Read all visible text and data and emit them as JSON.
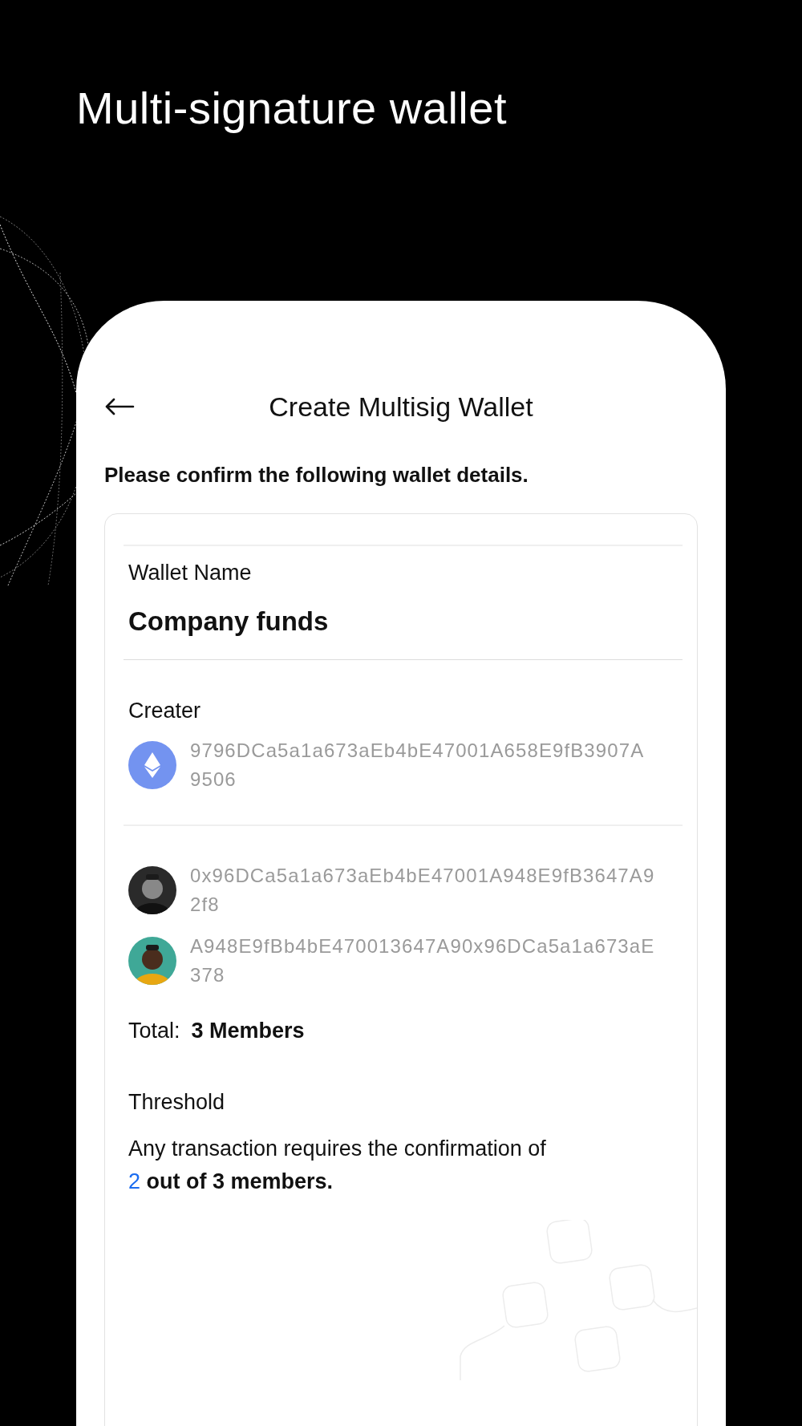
{
  "headline": "Multi-signature wallet",
  "screen": {
    "title": "Create Multisig Wallet",
    "intro": "Please confirm the following wallet details."
  },
  "card": {
    "wallet_name_label": "Wallet Name",
    "wallet_name": "Company funds",
    "creator_label": "Creater",
    "creator": {
      "kind": "token",
      "address": "9796DCa5a1a673aEb4bE47001A658E9fB3907A9506"
    },
    "members": [
      {
        "kind": "picture",
        "address": "0x96DCa5a1a673aEb4bE47001A948E9fB3647A92f8"
      },
      {
        "kind": "picture",
        "address": "A948E9fBb4bE470013647A90x96DCa5a1a673aE378"
      }
    ],
    "total_label": "Total:",
    "total_value": "3 Members",
    "threshold_label": "Threshold",
    "threshold_text_start": "Any transaction requires the confirmation of",
    "threshold_count": "2",
    "threshold_text_end": "out of 3 members."
  }
}
